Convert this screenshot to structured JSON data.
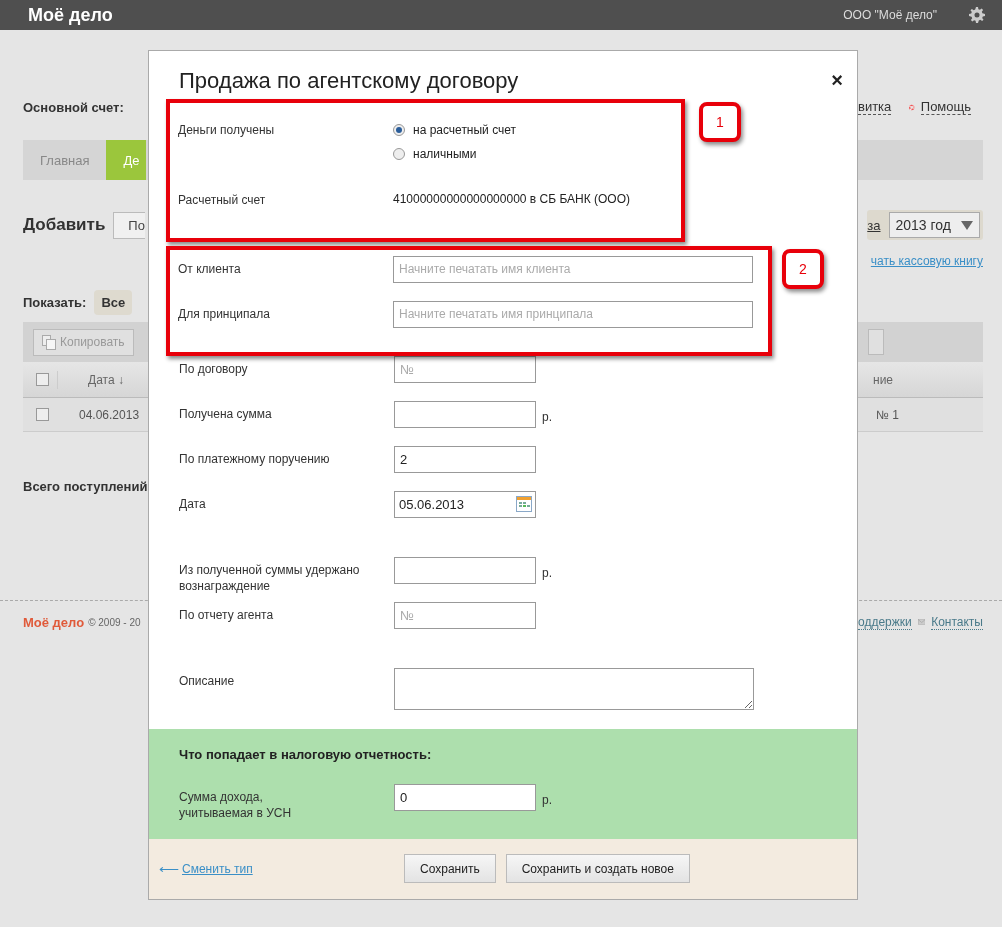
{
  "header": {
    "logo": "Моё дело",
    "company": "ООО \"Моё дело\""
  },
  "background": {
    "account_label": "Основной счет:",
    "help_link_fragment": "витка",
    "help_link": "Помощь",
    "tabs": [
      {
        "label": "Главная",
        "selected": false
      },
      {
        "label": "Де",
        "selected": true
      }
    ],
    "add_label": "Добавить",
    "add_button_fragment": "По",
    "period_fragment": "за",
    "year_select": "2013 год",
    "cashbook_link_fragment": "чать кассовую книгу",
    "show_label": "Показать:",
    "show_filter": "Все",
    "copy_button": "Копировать",
    "table": {
      "select_all_checked": false,
      "columns": [
        "Дата ↓",
        "ние"
      ],
      "rows": [
        {
          "checked": false,
          "cells": [
            "04.06.2013",
            "№ 1"
          ]
        }
      ]
    },
    "total_label": "Всего поступлений",
    "footer": {
      "logo": "Моё дело",
      "copyright": "© 2009 - 20",
      "support_fragment": "оддержки",
      "contacts": "Контакты"
    }
  },
  "dialog": {
    "title": "Продажа по агентскому договору",
    "close": "×",
    "annotations": [
      {
        "number": "1",
        "rows": [
          {
            "kind": "radio",
            "label": "Деньги получены",
            "options": [
              {
                "label": "на расчетный счет",
                "selected": true
              },
              {
                "label": "наличными",
                "selected": false
              }
            ]
          },
          {
            "kind": "text",
            "label": "Расчетный счет",
            "value": "41000000000000000000 в СБ БАНК (ООО)"
          }
        ]
      },
      {
        "number": "2",
        "rows": [
          {
            "kind": "wide_input",
            "label": "От клиента",
            "placeholder": "Начните печатать имя клиента"
          },
          {
            "kind": "wide_input",
            "label": "Для принципала",
            "placeholder": "Начните печатать имя принципала"
          }
        ]
      }
    ],
    "rows": [
      {
        "kind": "input",
        "label": "По договору",
        "placeholder": "№"
      },
      {
        "kind": "input",
        "label": "Получена сумма",
        "unit": "р."
      },
      {
        "kind": "input",
        "label": "По платежному поручению",
        "value": "2"
      },
      {
        "kind": "date",
        "label": "Дата",
        "value": "05.06.2013"
      },
      {
        "kind": "spacer"
      },
      {
        "kind": "input",
        "label": "Из полученной суммы удержано вознаграждение",
        "unit": "р."
      },
      {
        "kind": "input",
        "label": "По отчету агента",
        "placeholder": "№"
      },
      {
        "kind": "spacer"
      },
      {
        "kind": "textarea",
        "label": "Описание"
      }
    ],
    "tax_panel": {
      "heading": "Что попадает в налоговую отчетность:",
      "rows": [
        {
          "kind": "input",
          "label": "Сумма дохода, учитываемая в УСН",
          "value": "0",
          "unit": "р."
        }
      ]
    },
    "back_arrow": "⟵",
    "back_link": "Сменить тип",
    "buttons": [
      "Сохранить",
      "Сохранить и создать новое"
    ]
  }
}
